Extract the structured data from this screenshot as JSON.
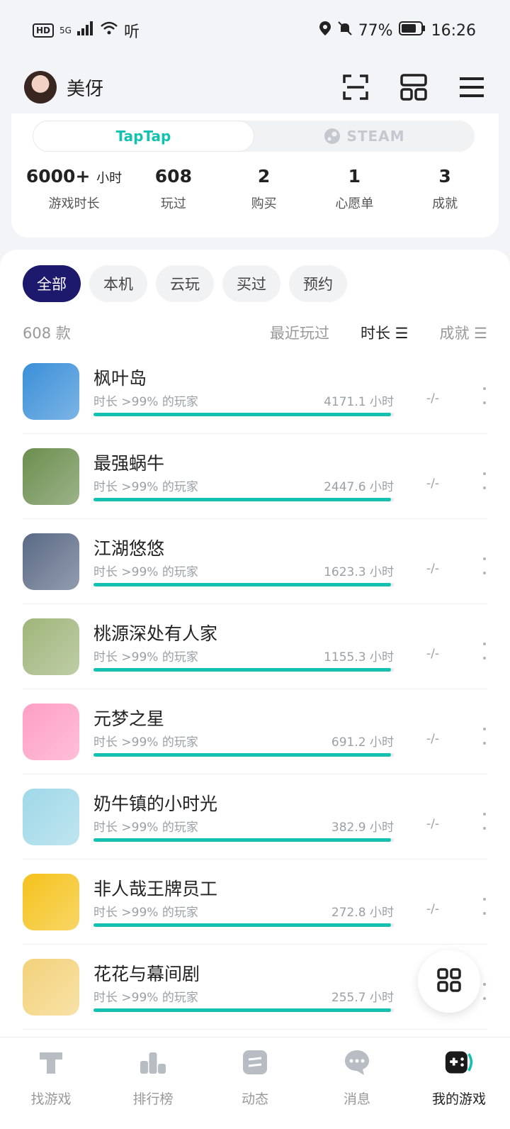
{
  "status_bar": {
    "hd": "HD",
    "network": "5G",
    "listen": "听",
    "battery": "77%",
    "time": "16:26"
  },
  "header": {
    "username": "美伢"
  },
  "platforms": {
    "taptap": "TapTap",
    "steam": "STEAM"
  },
  "stats": [
    {
      "value": "6000+",
      "unit": "小时",
      "label": "游戏时长"
    },
    {
      "value": "608",
      "unit": "",
      "label": "玩过"
    },
    {
      "value": "2",
      "unit": "",
      "label": "购买"
    },
    {
      "value": "1",
      "unit": "",
      "label": "心愿单"
    },
    {
      "value": "3",
      "unit": "",
      "label": "成就"
    }
  ],
  "filters": [
    "全部",
    "本机",
    "云玩",
    "买过",
    "预约"
  ],
  "count": "608 款",
  "sort": {
    "recent": "最近玩过",
    "duration": "时长 ☰",
    "achievement": "成就 ☰"
  },
  "games": [
    {
      "name": "枫叶岛",
      "sub": "时长 >99% 的玩家",
      "hours": "4171.1 小时",
      "ach": "-/-",
      "progress": 0.99,
      "icon_color": "#3a8fd8"
    },
    {
      "name": "最强蜗牛",
      "sub": "时长 >99% 的玩家",
      "hours": "2447.6 小时",
      "ach": "-/-",
      "progress": 0.99,
      "icon_color": "#6b8e4e"
    },
    {
      "name": "江湖悠悠",
      "sub": "时长 >99% 的玩家",
      "hours": "1623.3 小时",
      "ach": "-/-",
      "progress": 0.99,
      "icon_color": "#5a6a85"
    },
    {
      "name": "桃源深处有人家",
      "sub": "时长 >99% 的玩家",
      "hours": "1155.3 小时",
      "ach": "-/-",
      "progress": 0.99,
      "icon_color": "#9fb57a"
    },
    {
      "name": "元梦之星",
      "sub": "时长 >99% 的玩家",
      "hours": "691.2 小时",
      "ach": "-/-",
      "progress": 0.99,
      "icon_color": "#ff9fc4"
    },
    {
      "name": "奶牛镇的小时光",
      "sub": "时长 >99% 的玩家",
      "hours": "382.9 小时",
      "ach": "-/-",
      "progress": 0.99,
      "icon_color": "#9fd8e8"
    },
    {
      "name": "非人哉王牌员工",
      "sub": "时长 >99% 的玩家",
      "hours": "272.8 小时",
      "ach": "-/-",
      "progress": 0.99,
      "icon_color": "#f5c21b"
    },
    {
      "name": "花花与幕间剧",
      "sub": "时长 >99% 的玩家",
      "hours": "255.7 小时",
      "ach": "-/-",
      "progress": 0.99,
      "icon_color": "#f3d27a"
    }
  ],
  "nav": [
    "找游戏",
    "排行榜",
    "动态",
    "消息",
    "我的游戏"
  ],
  "colors": {
    "accent": "#14c1b1",
    "active_chip": "#1d1a6e"
  }
}
